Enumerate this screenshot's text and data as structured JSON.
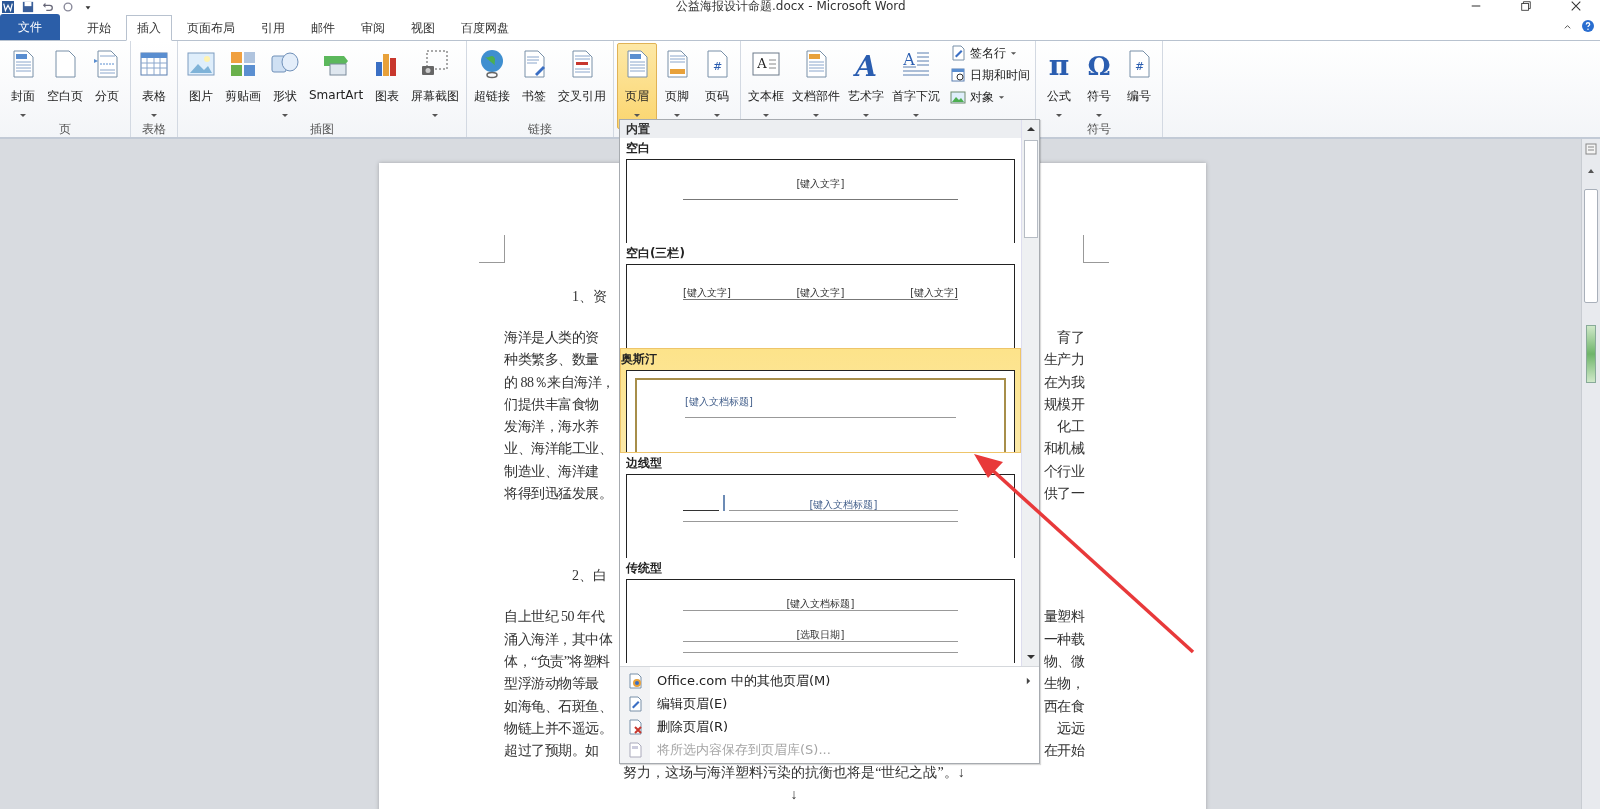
{
  "window": {
    "title": "公益海报设计命题.docx - Microsoft Word"
  },
  "tabs": [
    {
      "label": "文件",
      "kind": "file",
      "selected": false
    },
    {
      "label": "开始",
      "kind": "tab",
      "selected": false
    },
    {
      "label": "插入",
      "kind": "tab",
      "selected": true
    },
    {
      "label": "页面布局",
      "kind": "tab",
      "selected": false
    },
    {
      "label": "引用",
      "kind": "tab",
      "selected": false
    },
    {
      "label": "邮件",
      "kind": "tab",
      "selected": false
    },
    {
      "label": "审阅",
      "kind": "tab",
      "selected": false
    },
    {
      "label": "视图",
      "kind": "tab",
      "selected": false
    },
    {
      "label": "百度网盘",
      "kind": "tab",
      "selected": false
    }
  ],
  "ribbon": {
    "groups": [
      {
        "label": "页",
        "buttons": [
          {
            "label": "封面",
            "kind": "cover",
            "dropdown": true,
            "pressed": false
          },
          {
            "label": "空白页",
            "kind": "blank-page",
            "dropdown": false,
            "pressed": false
          },
          {
            "label": "分页",
            "kind": "page-break",
            "dropdown": false,
            "pressed": false
          }
        ]
      },
      {
        "label": "表格",
        "buttons": [
          {
            "label": "表格",
            "kind": "table",
            "dropdown": true,
            "pressed": false
          }
        ]
      },
      {
        "label": "插图",
        "buttons": [
          {
            "label": "图片",
            "kind": "picture",
            "dropdown": false,
            "pressed": false
          },
          {
            "label": "剪贴画",
            "kind": "clipart",
            "dropdown": false,
            "pressed": false
          },
          {
            "label": "形状",
            "kind": "shapes",
            "dropdown": true,
            "pressed": false
          },
          {
            "label": "SmartArt",
            "kind": "smartart",
            "dropdown": false,
            "pressed": false
          },
          {
            "label": "图表",
            "kind": "chart",
            "dropdown": false,
            "pressed": false
          },
          {
            "label": "屏幕截图",
            "kind": "screenshot",
            "dropdown": true,
            "pressed": false
          }
        ]
      },
      {
        "label": "链接",
        "buttons": [
          {
            "label": "超链接",
            "kind": "hyperlink",
            "dropdown": false,
            "pressed": false
          },
          {
            "label": "书签",
            "kind": "bookmark",
            "dropdown": false,
            "pressed": false
          },
          {
            "label": "交叉引用",
            "kind": "cross-reference",
            "dropdown": false,
            "pressed": false
          }
        ]
      },
      {
        "buttons": [
          {
            "label": "页眉",
            "kind": "header",
            "dropdown": true,
            "pressed": true
          },
          {
            "label": "页脚",
            "kind": "footer",
            "dropdown": true,
            "pressed": false
          },
          {
            "label": "页码",
            "kind": "page-number",
            "glyph": "#",
            "dropdown": true,
            "pressed": false
          }
        ]
      },
      {
        "buttons": [
          {
            "label": "文本框",
            "kind": "textbox",
            "glyph": "A",
            "dropdown": true,
            "pressed": false
          },
          {
            "label": "文档部件",
            "kind": "quick-parts",
            "dropdown": true,
            "pressed": false
          },
          {
            "label": "艺术字",
            "kind": "wordart",
            "glyph": "A",
            "dropdown": true,
            "pressed": false
          },
          {
            "label": "首字下沉",
            "kind": "dropcap",
            "glyph": "A",
            "dropdown": true,
            "pressed": false
          }
        ],
        "small_buttons": [
          {
            "label": "签名行",
            "kind": "signature",
            "dropdown": true
          },
          {
            "label": "日期和时间",
            "kind": "datetime",
            "dropdown": false
          },
          {
            "label": "对象",
            "kind": "object",
            "dropdown": true
          }
        ]
      },
      {
        "label": "符号",
        "buttons": [
          {
            "label": "公式",
            "kind": "equation",
            "glyph": "π",
            "dropdown": true,
            "pressed": false
          },
          {
            "label": "符号",
            "kind": "symbol",
            "glyph": "Ω",
            "dropdown": true,
            "pressed": false
          },
          {
            "label": "编号",
            "kind": "number",
            "glyph": "#",
            "dropdown": false,
            "pressed": false
          }
        ]
      }
    ]
  },
  "document": {
    "blocks": [
      {
        "kind": "heading",
        "text": "1、资"
      },
      {
        "kind": "paragraph",
        "lines": [
          {
            "left": "海洋是人类的资",
            "right": "育了"
          },
          {
            "left": "种类繁多、数量",
            "right": "生产力"
          },
          {
            "left": "的 88％来自海洋，",
            "right": "在为我"
          },
          {
            "left": "们提供丰富食物",
            "right": "规模开"
          },
          {
            "left": "发海洋，海水养",
            "right": "化工"
          },
          {
            "left": "业、海洋能工业、",
            "right": "和机械"
          },
          {
            "left": "制造业、海洋建",
            "right": "个行业"
          },
          {
            "left": "将得到迅猛发展。",
            "right": "供了一"
          }
        ]
      },
      {
        "kind": "heading",
        "text": "2、白"
      },
      {
        "kind": "paragraph",
        "lines": [
          {
            "left": "自上世纪 50 年代",
            "right": "量塑料"
          },
          {
            "left": "涌入海洋，其中体",
            "right": "一种载"
          },
          {
            "left": "体，“负责”将塑料",
            "right": "物、微"
          },
          {
            "left": "型浮游动物等最",
            "right": "生物，"
          },
          {
            "left": "如海龟、石斑鱼、",
            "right": "西在食"
          },
          {
            "left": "物链上并不遥远。",
            "right": "远远"
          },
          {
            "left": "超过了预期。如",
            "right": "在开始"
          }
        ]
      },
      {
        "kind": "centered",
        "text": "努力，这场与海洋塑料污染的抗衡也将是“世纪之战”。↓"
      },
      {
        "kind": "centered",
        "text": "↓"
      }
    ]
  },
  "header_menu": {
    "section": "内置",
    "gallery": [
      {
        "label": "空白",
        "kind": "blank",
        "selected": false,
        "preview_texts": [
          "[键入文字]"
        ]
      },
      {
        "label": "空白(三栏)",
        "kind": "three-column",
        "selected": false,
        "preview_texts": [
          "[键入文字]",
          "[键入文字]",
          "[键入文字]"
        ]
      },
      {
        "label": "奥斯汀",
        "kind": "austin",
        "selected": true,
        "preview_texts": [
          "[键入文档标题]"
        ]
      },
      {
        "label": "边线型",
        "kind": "sideline",
        "selected": false,
        "preview_texts": [
          "[键入文档标题]"
        ]
      },
      {
        "label": "传统型",
        "kind": "traditional",
        "selected": false,
        "preview_texts": [
          "[键入文档标题]",
          "[选取日期]"
        ]
      }
    ],
    "commands": [
      {
        "label": "Office.com 中的其他页眉(M)",
        "kind": "more",
        "submenu": true,
        "disabled": false
      },
      {
        "label": "编辑页眉(E)",
        "kind": "edit",
        "submenu": false,
        "disabled": false
      },
      {
        "label": "删除页眉(R)",
        "kind": "remove",
        "submenu": false,
        "disabled": false
      },
      {
        "label": "将所选内容保存到页眉库(S)...",
        "kind": "save",
        "submenu": false,
        "disabled": true
      }
    ]
  }
}
